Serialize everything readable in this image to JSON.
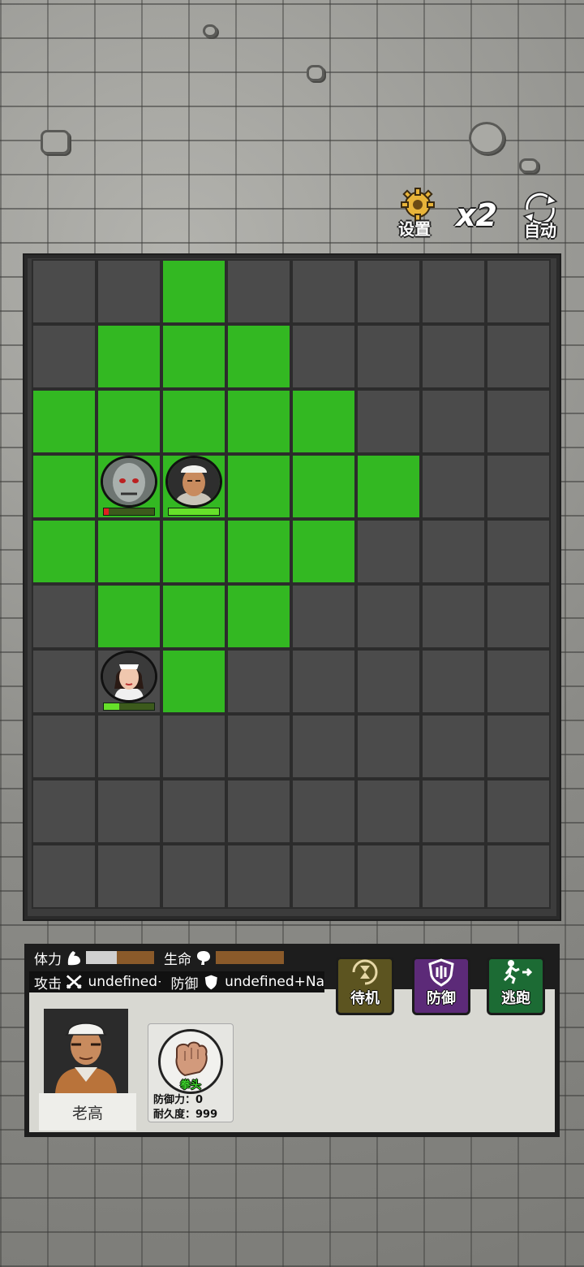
{
  "top_bar": {
    "settings_label": "设置",
    "speed_label": "x2",
    "auto_label": "自动"
  },
  "board": {
    "cols": 8,
    "rows": 10,
    "highlighted_cells": [
      [
        0,
        2
      ],
      [
        1,
        1
      ],
      [
        1,
        2
      ],
      [
        1,
        3
      ],
      [
        2,
        0
      ],
      [
        2,
        1
      ],
      [
        2,
        2
      ],
      [
        2,
        3
      ],
      [
        2,
        4
      ],
      [
        3,
        0
      ],
      [
        3,
        1
      ],
      [
        3,
        2
      ],
      [
        3,
        3
      ],
      [
        3,
        4
      ],
      [
        3,
        5
      ],
      [
        4,
        0
      ],
      [
        4,
        1
      ],
      [
        4,
        2
      ],
      [
        4,
        3
      ],
      [
        4,
        4
      ],
      [
        5,
        1
      ],
      [
        5,
        2
      ],
      [
        5,
        3
      ],
      [
        6,
        2
      ]
    ],
    "units": [
      {
        "id": "zombie",
        "row": 3,
        "col": 1,
        "hp_fraction": 0.1,
        "hp_color": "#e02020",
        "icon": "zombie-portrait"
      },
      {
        "id": "player",
        "row": 3,
        "col": 2,
        "hp_fraction": 1.0,
        "hp_color": "#66e02a",
        "icon": "worker-portrait"
      },
      {
        "id": "nurse",
        "row": 6,
        "col": 1,
        "hp_fraction": 0.3,
        "hp_color": "#66e02a",
        "icon": "nurse-portrait"
      }
    ],
    "colors": {
      "highlight": "#33b822",
      "cell": "#4b4b4b"
    }
  },
  "stats": {
    "stamina_label": "体力",
    "stamina_fraction": 0.45,
    "life_label": "生命",
    "life_fraction": 0.0,
    "attack_label": "攻击",
    "attack_value": "undefined+NaN",
    "defense_label": "防御",
    "defense_value": "undefined+Na"
  },
  "actions": {
    "standby_label": "待机",
    "defend_label": "防御",
    "flee_label": "逃跑"
  },
  "character": {
    "name": "老高"
  },
  "weapon": {
    "name": "拳头",
    "defense_label": "防御力：",
    "defense_value": "0",
    "durability_label": "耐久度：",
    "durability_value": "999"
  }
}
